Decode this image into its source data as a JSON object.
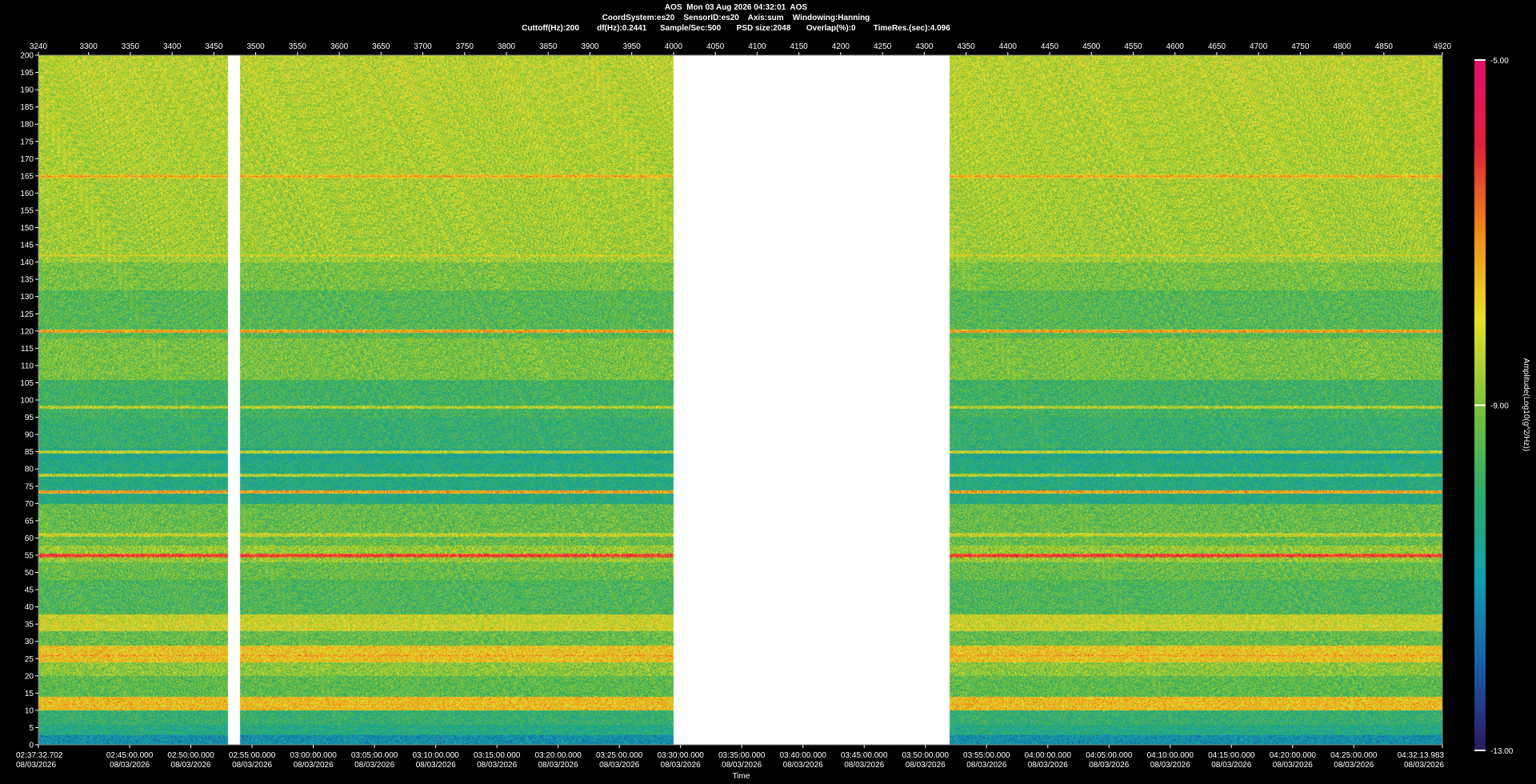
{
  "header": {
    "line1": "AOS  Mon 03 Aug 2026 04:32:01  AOS",
    "line2": "CoordSystem:es20    SensorID:es20    Axis:sum    Windowing:Hanning",
    "line3": "Cuttoff(Hz):200        df(Hz):0.2441      Sample/Sec:500       PSD size:2048       Overlap(%):0        TimeRes.(sec):4.096"
  },
  "chart_data": {
    "type": "heatmap",
    "title": "AOS  Mon 03 Aug 2026 04:32:01  AOS",
    "xlabel": "Time",
    "ylabel": "",
    "colorbar_label": "Amplitude(Log10(g^2/Hz))",
    "colorbar_ticks": [
      "-5.00",
      "-9.00",
      "-13.00"
    ],
    "colorbar_range": [
      -13,
      -5
    ],
    "colors": [
      "#2a1a5e",
      "#1a5ea8",
      "#12a0b0",
      "#2eaa6a",
      "#7cc23a",
      "#e8e02a",
      "#f08a1a",
      "#e0203a",
      "#e0106a"
    ],
    "ylim": [
      0,
      200
    ],
    "y_ticks": [
      0,
      5,
      10,
      15,
      20,
      25,
      30,
      35,
      40,
      45,
      50,
      55,
      60,
      65,
      70,
      75,
      80,
      85,
      90,
      95,
      100,
      105,
      110,
      115,
      120,
      125,
      130,
      135,
      140,
      145,
      150,
      155,
      160,
      165,
      170,
      175,
      180,
      185,
      190,
      195,
      200
    ],
    "top_xlim": [
      3240,
      4920
    ],
    "top_x_ticks": [
      3240,
      3300,
      3350,
      3400,
      3450,
      3500,
      3550,
      3600,
      3650,
      3700,
      3750,
      3800,
      3850,
      3900,
      3950,
      4000,
      4050,
      4100,
      4150,
      4200,
      4250,
      4300,
      4350,
      4400,
      4450,
      4500,
      4550,
      4600,
      4650,
      4700,
      4750,
      4800,
      4850,
      4920
    ],
    "bottom_x_ticks": [
      {
        "time": "02:37:32.702",
        "date": "08/03/2026"
      },
      {
        "time": "02:45:00.000",
        "date": "08/03/2026"
      },
      {
        "time": "02:50:00.000",
        "date": "08/03/2026"
      },
      {
        "time": "02:55:00.000",
        "date": "08/03/2026"
      },
      {
        "time": "03:00:00.000",
        "date": "08/03/2026"
      },
      {
        "time": "03:05:00.000",
        "date": "08/03/2026"
      },
      {
        "time": "03:10:00.000",
        "date": "08/03/2026"
      },
      {
        "time": "03:15:00.000",
        "date": "08/03/2026"
      },
      {
        "time": "03:20:00.000",
        "date": "08/03/2026"
      },
      {
        "time": "03:25:00.000",
        "date": "08/03/2026"
      },
      {
        "time": "03:30:00.000",
        "date": "08/03/2026"
      },
      {
        "time": "03:35:00.000",
        "date": "08/03/2026"
      },
      {
        "time": "03:40:00.000",
        "date": "08/03/2026"
      },
      {
        "time": "03:45:00.000",
        "date": "08/03/2026"
      },
      {
        "time": "03:50:00.000",
        "date": "08/03/2026"
      },
      {
        "time": "03:55:00.000",
        "date": "08/03/2026"
      },
      {
        "time": "04:00:00.000",
        "date": "08/03/2026"
      },
      {
        "time": "04:05:00.000",
        "date": "08/03/2026"
      },
      {
        "time": "04:10:00.000",
        "date": "08/03/2026"
      },
      {
        "time": "04:15:00.000",
        "date": "08/03/2026"
      },
      {
        "time": "04:20:00.000",
        "date": "08/03/2026"
      },
      {
        "time": "04:25:00.000",
        "date": "08/03/2026"
      },
      {
        "time": "04:32:13.983",
        "date": "08/03/2026"
      }
    ],
    "data_gaps_top_axis": [
      [
        3466,
        3481
      ],
      [
        4000,
        4330
      ]
    ],
    "persistent_lines_hz": [
      {
        "hz": 165,
        "level": -7.2
      },
      {
        "hz": 142,
        "level": -8.0
      },
      {
        "hz": 120,
        "level": -7.0
      },
      {
        "hz": 98,
        "level": -8.2
      },
      {
        "hz": 85,
        "level": -8.0
      },
      {
        "hz": 78.3,
        "level": -8.2
      },
      {
        "hz": 73.5,
        "level": -7.0
      },
      {
        "hz": 61,
        "level": -8.0
      },
      {
        "hz": 55,
        "level": -6.0
      },
      {
        "hz": 26,
        "level": -7.2
      }
    ]
  }
}
